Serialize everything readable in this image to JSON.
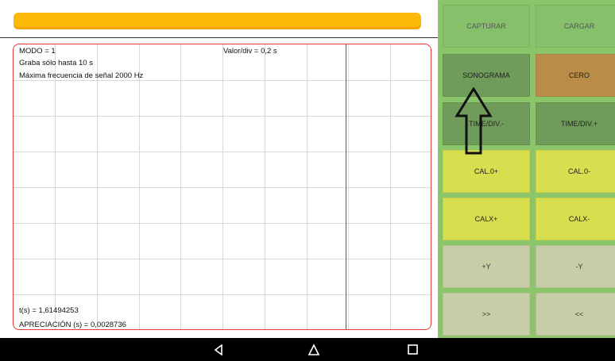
{
  "colors": {
    "accent": "#fdb909",
    "panel": "#8bc56a",
    "scope_border": "#e53935",
    "cursor": "#3a4fd8"
  },
  "scope": {
    "modo": "MODO = 1",
    "valor_div": "Valor/div = 0,2 s",
    "graba": "Graba sólo hasta 10 s",
    "max_freq": "Máxima frecuencia de señal 2000 Hz",
    "time_readout": "t(s) = 1,61494253",
    "apreciacion": "APRECIACIÓN (s) = 0,0028736"
  },
  "buttons": {
    "capturar": "CAPTURAR",
    "cargar": "CARGAR",
    "sonograma": "SONOGRAMA",
    "cero": "CERO",
    "time_div_minus": "TIME/DIV.-",
    "time_div_plus": "TIME/DIV.+",
    "cal0_plus": "CAL.0+",
    "cal0_minus": "CAL.0-",
    "calx_plus": "CALX+",
    "calx_minus": "CALX-",
    "y_plus": "+Y",
    "y_minus": "-Y",
    "forward": ">>",
    "back": "<<"
  },
  "navbar": {
    "icons": [
      "back-icon",
      "home-icon",
      "recents-icon"
    ]
  }
}
